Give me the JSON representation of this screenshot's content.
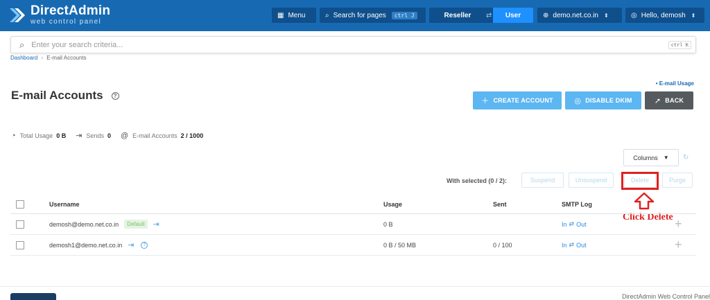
{
  "header": {
    "logo_title": "DirectAdmin",
    "logo_subtitle": "web control panel",
    "menu_label": "Menu",
    "search_pages_label": "Search for pages",
    "search_pages_kbd": "ctrl J",
    "reseller_label": "Reseller",
    "user_label": "User",
    "domain_label": "demo.net.co.in",
    "greeting_label": "Hello, demosh",
    "brand_color": "#176ab2"
  },
  "search": {
    "placeholder": "Enter your search criteria...",
    "kbd": "ctrl K"
  },
  "breadcrumb": {
    "items": [
      "Dashboard",
      "E-mail Accounts"
    ],
    "separator": "›"
  },
  "page": {
    "title": "E-mail Accounts",
    "email_usage_link": "• E-mail Usage",
    "create_account_label": "CREATE ACCOUNT",
    "disable_dkim_label": "DISABLE DKIM",
    "back_label": "BACK"
  },
  "stats": {
    "total_usage_label": "Total Usage",
    "total_usage_value": "0 B",
    "sends_label": "Sends",
    "sends_value": "0",
    "accounts_label": "E-mail Accounts",
    "accounts_value": "2 / 1000"
  },
  "toolbar": {
    "columns_label": "Columns",
    "with_selected_label": "With selected (0 / 2):",
    "suspend_label": "Suspend",
    "unsuspend_label": "Unsuspend",
    "delete_label": "Delete",
    "purge_label": "Purge"
  },
  "annotation": {
    "text": "Click Delete",
    "color": "#e02020"
  },
  "table": {
    "columns": [
      "Username",
      "Usage",
      "Sent",
      "SMTP Log"
    ],
    "rows": [
      {
        "username": "demosh@demo.net.co.in",
        "badge": "Default",
        "usage": "0 B",
        "sent": "",
        "smtp_in": "In",
        "smtp_arrow": "⇄",
        "smtp_out": "Out"
      },
      {
        "username": "demosh1@demo.net.co.in",
        "badge": "",
        "usage": "0 B / 50 MB",
        "sent": "0 / 100",
        "smtp_in": "In",
        "smtp_arrow": "⇄",
        "smtp_out": "Out"
      }
    ]
  },
  "footer": {
    "text": "DirectAdmin Web Control Panel"
  }
}
